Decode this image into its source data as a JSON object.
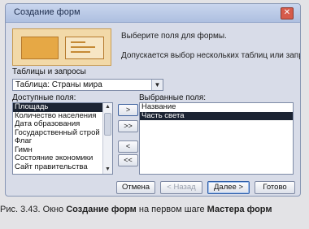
{
  "window": {
    "title": "Создание форм",
    "close_glyph": "✕"
  },
  "intro": {
    "line1": "Выберите поля для формы.",
    "line2": "Допускается выбор нескольких таблиц или запросов."
  },
  "source": {
    "label": "Таблицы и запросы",
    "selected": "Таблица: Страны мира"
  },
  "available": {
    "label": "Доступные поля:",
    "items": [
      "Площадь",
      "Количество населения",
      "Дата образования",
      "Государственный строй",
      "Флаг",
      "Гимн",
      "Состояние экономики",
      "Сайт правительства"
    ],
    "selected_index": 0
  },
  "selected_fields": {
    "label": "Выбранные поля:",
    "items": [
      "Название",
      "Часть света"
    ],
    "selected_index": 1
  },
  "move_buttons": {
    "add_one": ">",
    "add_all": ">>",
    "remove_one": "<",
    "remove_all": "<<"
  },
  "footer": {
    "cancel": "Отмена",
    "back": "< Назад",
    "next": "Далее >",
    "finish": "Готово"
  },
  "caption": {
    "prefix": "Рис. 3.43. Окно ",
    "bold1": "Создание форм",
    "middle": " на первом шаге ",
    "bold2": "Мастера форм"
  }
}
